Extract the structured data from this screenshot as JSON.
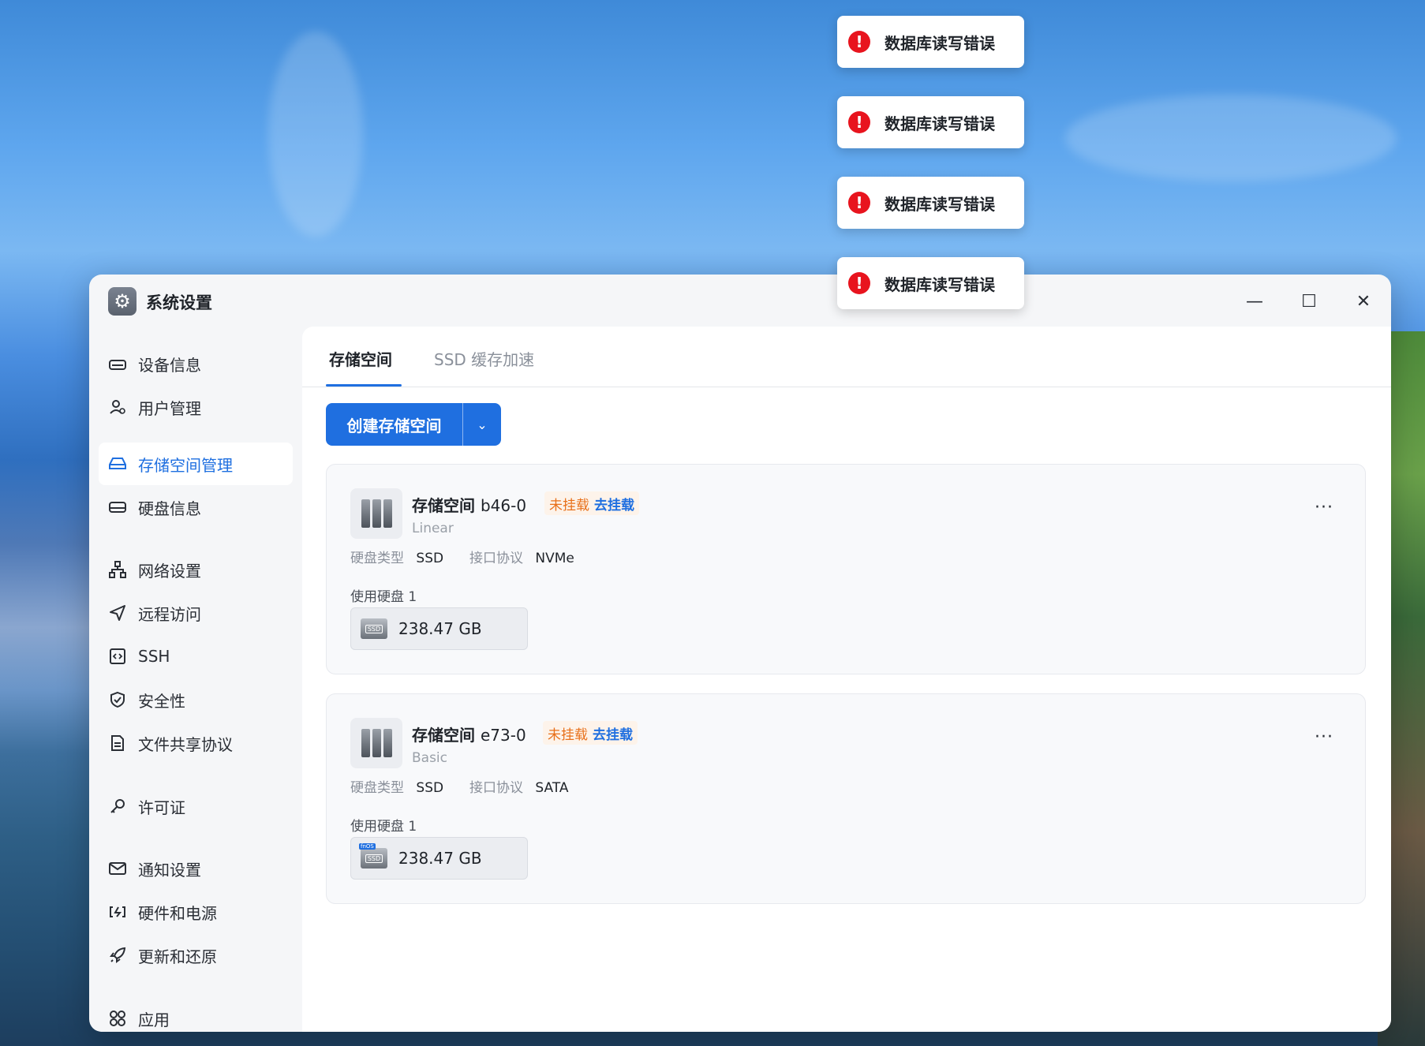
{
  "toasts": [
    {
      "text": "数据库读写错误",
      "icon": "error-icon"
    },
    {
      "text": "数据库读写错误",
      "icon": "error-icon"
    },
    {
      "text": "数据库读写错误",
      "icon": "error-icon"
    },
    {
      "text": "数据库读写错误",
      "icon": "error-icon"
    }
  ],
  "window": {
    "title": "系统设置",
    "icon": "gear-icon",
    "controls": {
      "minimize": "—",
      "maximize": "☐",
      "close": "✕"
    }
  },
  "sidebar": {
    "items": [
      {
        "label": "设备信息",
        "icon": "device-icon",
        "active": false
      },
      {
        "label": "用户管理",
        "icon": "user-icon",
        "active": false
      },
      {
        "label": "存储空间管理",
        "icon": "storage-icon",
        "active": true
      },
      {
        "label": "硬盘信息",
        "icon": "disk-icon",
        "active": false
      },
      {
        "label": "网络设置",
        "icon": "network-icon",
        "active": false
      },
      {
        "label": "远程访问",
        "icon": "send-icon",
        "active": false
      },
      {
        "label": "SSH",
        "icon": "code-icon",
        "active": false
      },
      {
        "label": "安全性",
        "icon": "shield-icon",
        "active": false
      },
      {
        "label": "文件共享协议",
        "icon": "file-icon",
        "active": false
      },
      {
        "label": "许可证",
        "icon": "key-icon",
        "active": false
      },
      {
        "label": "通知设置",
        "icon": "mail-icon",
        "active": false
      },
      {
        "label": "硬件和电源",
        "icon": "power-icon",
        "active": false
      },
      {
        "label": "更新和还原",
        "icon": "rocket-icon",
        "active": false
      },
      {
        "label": "应用",
        "icon": "apps-icon",
        "active": false
      }
    ]
  },
  "main": {
    "tabs": [
      {
        "label": "存储空间",
        "active": true
      },
      {
        "label": "SSD 缓存加速",
        "active": false
      }
    ],
    "create_button": {
      "label": "创建存储空间",
      "caret": "⌄"
    },
    "cards": [
      {
        "name": "存储空间",
        "id": "b46-0",
        "status": "未挂载",
        "action": "去挂载",
        "raid": "Linear",
        "disk_type_label": "硬盘类型",
        "disk_type": "SSD",
        "protocol_label": "接口协议",
        "protocol": "NVMe",
        "disks_caption": "使用硬盘 1",
        "disk_size": "238.47 GB",
        "ssd_text": "SSD",
        "ssd_tag": "",
        "more": "···"
      },
      {
        "name": "存储空间",
        "id": "e73-0",
        "status": "未挂载",
        "action": "去挂载",
        "raid": "Basic",
        "disk_type_label": "硬盘类型",
        "disk_type": "SSD",
        "protocol_label": "接口协议",
        "protocol": "SATA",
        "disks_caption": "使用硬盘 1",
        "disk_size": "238.47 GB",
        "ssd_text": "SSD",
        "ssd_tag": "fnOS",
        "more": "···"
      }
    ]
  },
  "colors": {
    "accent": "#1f6fe0",
    "error": "#e8141e",
    "warning": "#e8701a"
  }
}
